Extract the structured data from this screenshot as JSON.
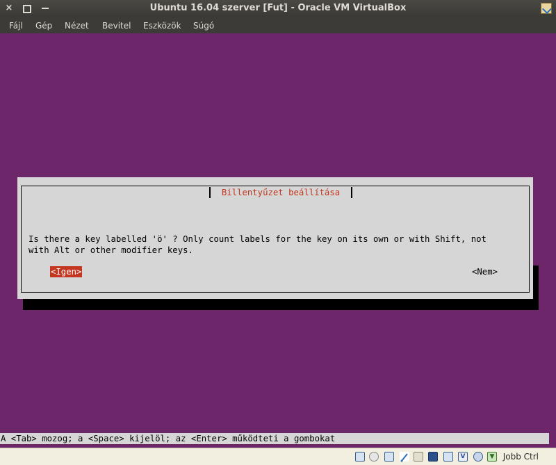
{
  "window": {
    "title": "Ubuntu 16.04 szerver [Fut] - Oracle VM VirtualBox",
    "controls": {
      "close": "×",
      "maximize": "▫",
      "minimize": "–"
    }
  },
  "menu": {
    "items": [
      "Fájl",
      "Gép",
      "Nézet",
      "Bevitel",
      "Eszközök",
      "Súgó"
    ]
  },
  "dialog": {
    "title": "Billentyűzet beállítása",
    "line1": "Is there a key labelled 'ö' ? Only count labels for the key on its own or with Shift, not",
    "line2": "with Alt or other modifier keys.",
    "yes_label": "<Igen>",
    "no_label": "<Nem>"
  },
  "guest_status": "A <Tab> mozog; a <Space> kijelöl; az <Enter> működteti a gombokat",
  "statusbar": {
    "host_key": "Jobb Ctrl",
    "icons": [
      "hard-disk-icon",
      "optical-drive-icon",
      "network-icon",
      "usb-icon",
      "shared-folders-icon",
      "display-icon",
      "video-capture-icon",
      "vrde-icon",
      "cpu-virtualization-icon",
      "mouse-integration-icon",
      "host-key-arrow-icon"
    ]
  },
  "colors": {
    "guest_background": "#6e266a",
    "dialog_background": "#d6d6d6",
    "accent_red": "#c4361f"
  }
}
